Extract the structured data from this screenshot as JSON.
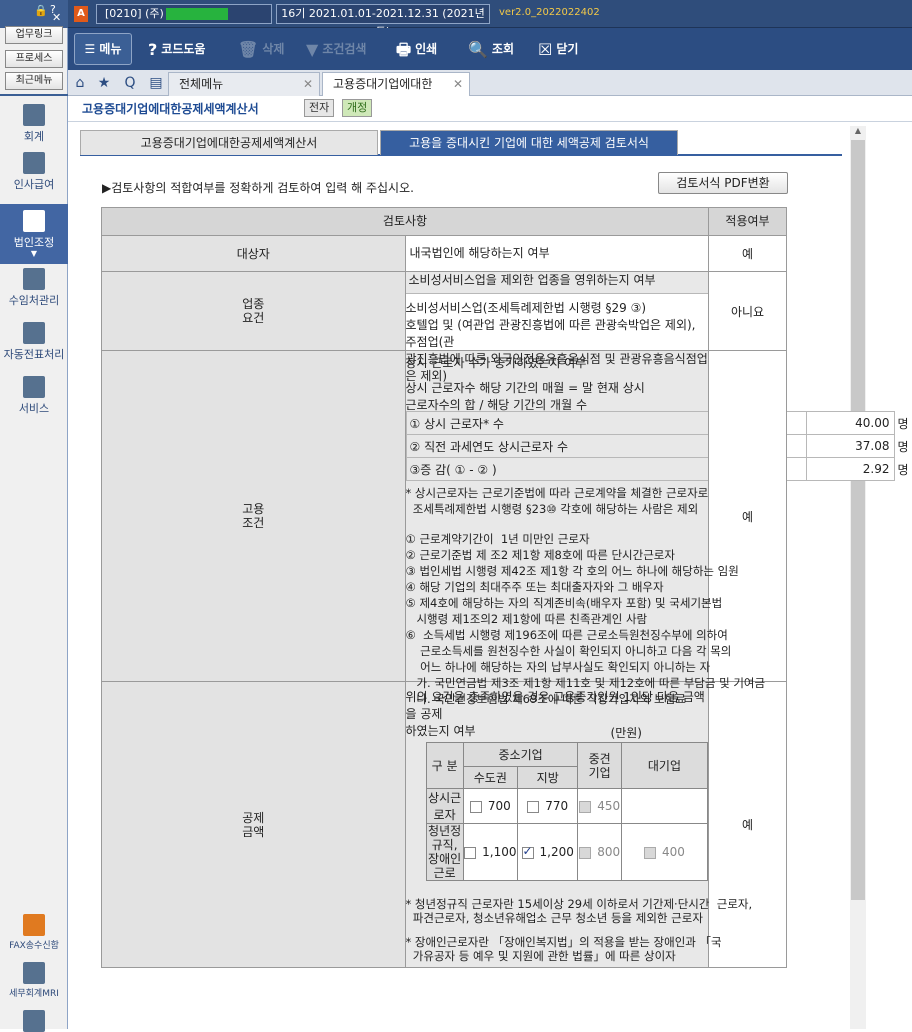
{
  "titlebar": {
    "app_letter": "A",
    "company": "[0210] (주)",
    "period": "16기 2021.01.01-2021.12.31 (2021년도)",
    "version": "ver2.0_2022022402"
  },
  "toolbar": {
    "menu": "메뉴",
    "code_help": "코드도움",
    "delete": "삭제",
    "condition_search": "조건검색",
    "print": "인쇄",
    "inquiry": "조회",
    "close": "닫기"
  },
  "sidebar": {
    "quick_buttons": [
      "업무링크",
      "프로세스",
      "최근메뉴"
    ],
    "items": [
      {
        "label": "회계"
      },
      {
        "label": "인사급여"
      },
      {
        "label": "법인조정"
      },
      {
        "label": "수임처관리"
      },
      {
        "label": "자동전표처리"
      },
      {
        "label": "서비스"
      }
    ],
    "bottom_items": [
      {
        "label": "FAX송수신함"
      },
      {
        "label": "세무회계MRI"
      }
    ]
  },
  "tabs": [
    {
      "label": "전체메뉴"
    },
    {
      "label": "고용증대기업에대한"
    }
  ],
  "page": {
    "title": "고용증대기업에대한공제세액계산서",
    "badge_edoc": "전자",
    "badge_revised": "개정",
    "subtab1": "고용증대기업에대한공제세액계산서",
    "subtab2": "고용을 증대시킨 기업에 대한 세액공제 검토서식",
    "instruction": "▶검토사항의 적합여부를 정확하게 검토하여 입력 해 주십시오.",
    "pdf_button": "검토서식 PDF변환"
  },
  "review": {
    "header_item": "검토사항",
    "header_apply": "적용여부",
    "target": {
      "cat": "대상자",
      "text": "내국법인에 해당하는지 여부",
      "answer": "예"
    },
    "industry": {
      "cat": "업종요건",
      "q": "소비성서비스업을 제외한 업종을 영위하는지 여부",
      "detail": "소비성서비스업(조세특례제한법 시행령 §29 ③)\n호텔업 및 (여관업 관광진흥법에 따른 관광숙박업은 제외), 주점업(관\n광진흥법에 따른 외국인전용유흥음식점 및 관광유흥음식점업은 제외)",
      "answer": "아니요"
    },
    "employment": {
      "cat": "고용조건",
      "q": "상시 근로자 수가 증가하였는지 여부",
      "formula": "상시 근로자수 해당 기간의 매월 = 말 현재 상시\n근로자수의 합 / 해당 기간의 개월 수",
      "rows": [
        {
          "label": "① 상시 근로자* 수",
          "value": "40.00",
          "unit": "명"
        },
        {
          "label": "② 직전 과세연도  상시근로자 수",
          "value": "37.08",
          "unit": "명"
        },
        {
          "label": "③증      감( ① - ② )",
          "value": "2.92",
          "unit": "명"
        }
      ],
      "notes": "* 상시근로자는 근로기준법에 따라 근로계약을 체결한 근로자로\n  조세특례제한법 시행령 §23⑩ 각호에 해당하는 사람은 제외\n\n① 근로계약기간이  1년 미만인 근로자\n② 근로기준법 제 조2 제1항 제8호에 따른 단시간근로자\n③ 법인세법 시행령 제42조 제1항 각 호의 어느 하나에 해당하는 임원\n④ 해당 기업의 최대주주 또는 최대출자자와 그 배우자\n⑤ 제4호에 해당하는 자의 직계존비속(배우자 포함) 및 국세기본법\n   시행령 제1조의2 제1항에 따른 친족관계인 사람\n⑥  소득세법 시행령 제196조에 따른 근로소득원천징수부에 의하여\n    근로소득세를 원천징수한 사실이 확인되지 아니하고 다음 각 목의\n    어느 하나에 해당하는 자의 납부사실도 확인되지 아니하는 자\n   가. 국민연금법 제3조 제1항 제11호 및 제12호에 따른 부담금 및 기여금\n   나. 국민건강보험법 제69조에 따른 직장가입자의 보험료",
      "answer": "예"
    },
    "deduction": {
      "cat": "공제금액",
      "q": "위의 요건을 충족하였을 경우 고용증가인원 1인당 다음 금액을 공제\n하였는지 여부",
      "unit": "(만원)",
      "col_type": "구 분",
      "col_sme": "중소기업",
      "col_capital": "수도권",
      "col_local": "지방",
      "col_mid": "중견\n기업",
      "col_large": "대기업",
      "rows": [
        {
          "label": "상시근로자",
          "capital": "700",
          "local": "770",
          "mid": "450",
          "large": ""
        },
        {
          "label": "청년정규직,\n장애인근로",
          "capital": "1,100",
          "local": "1,200",
          "mid": "800",
          "large": "400"
        }
      ],
      "note1": "* 청년정규직 근로자란 15세이상 29세 이하로서 기간제·단시간  근로자,\n  파견근로자, 청소년유해업소 근무 청소년 등을 제외한 근로자",
      "note2": "* 장애인근로자란 「장애인복지법」의 적용을 받는 장애인과 「국\n  가유공자 등 예우 및 지원에 관한 법률」에 따른 상이자",
      "answer": "예"
    }
  }
}
